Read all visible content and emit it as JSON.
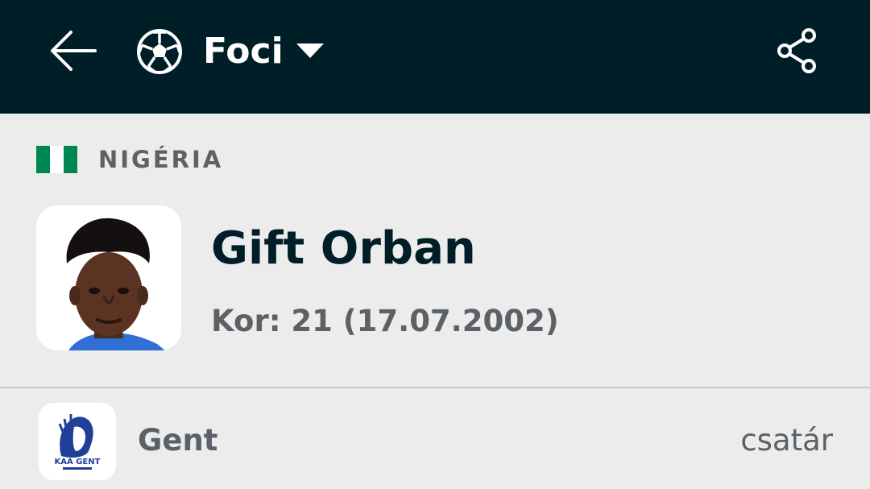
{
  "header": {
    "sport_label": "Foci",
    "back_icon": "arrow-left-icon",
    "sport_icon": "soccer-ball-icon",
    "dropdown_icon": "caret-down-icon",
    "share_icon": "share-icon",
    "background_color": "#001e28"
  },
  "player": {
    "country": "NIGÉRIA",
    "flag_colors": [
      "#008751",
      "#ffffff",
      "#008751"
    ],
    "name": "Gift Orban",
    "age_text": "Kor: 21 (17.07.2002)"
  },
  "team": {
    "name": "Gent",
    "position": "csatár",
    "logo_text": "KAA GENT"
  }
}
